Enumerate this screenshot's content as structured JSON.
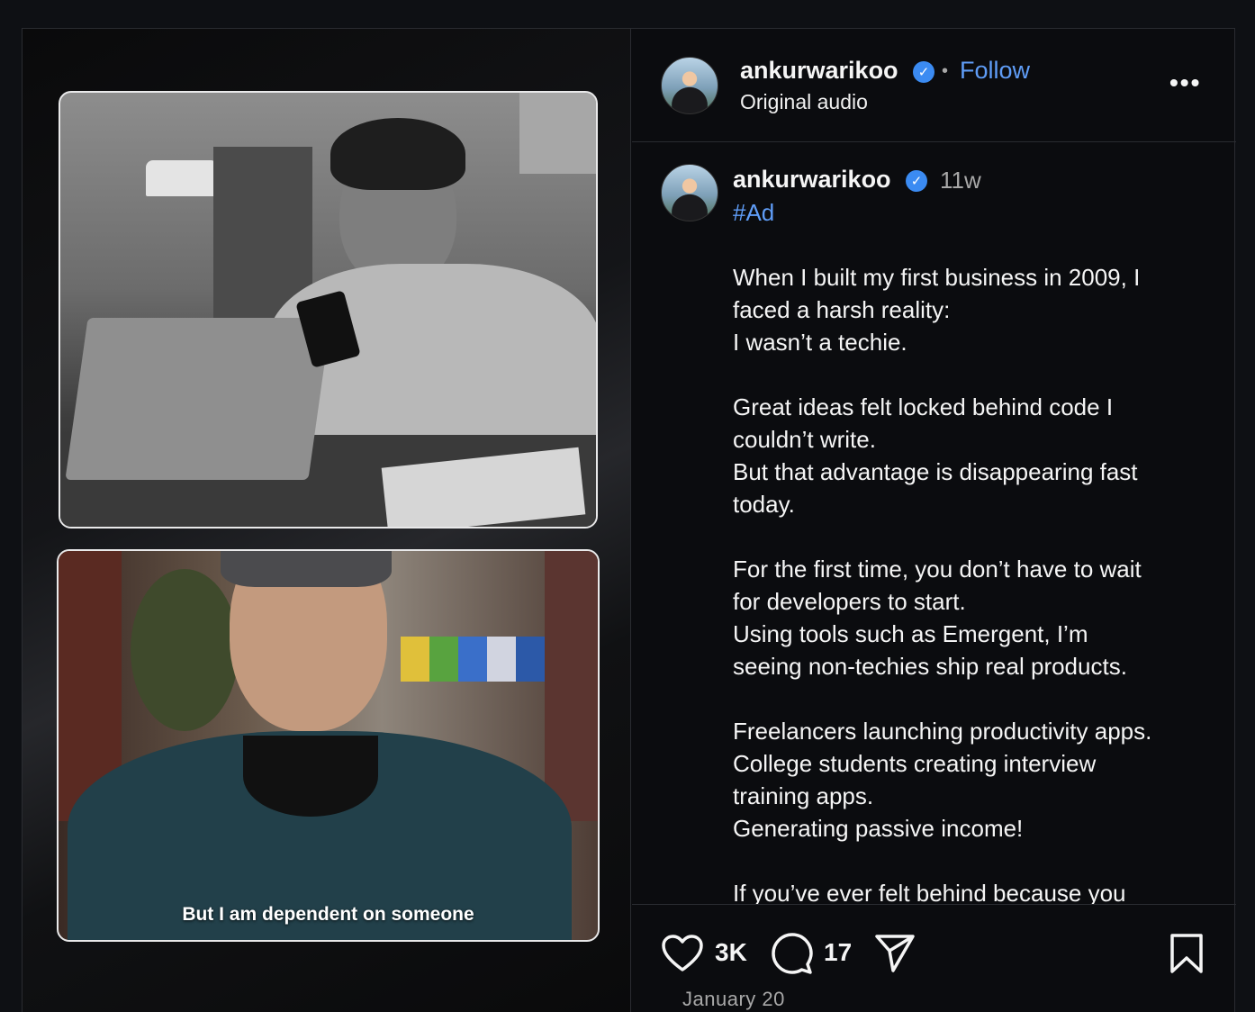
{
  "header": {
    "username": "ankurwarikoo",
    "separator": "•",
    "follow_label": "Follow",
    "subtitle": "Original audio",
    "more_label": "•••"
  },
  "post": {
    "username": "ankurwarikoo",
    "time_ago": "11w",
    "hashtag": "#Ad",
    "paragraphs": [
      [
        "When I built my first business in 2009, I",
        "faced a harsh reality:",
        "I wasn’t a techie."
      ],
      [
        "Great ideas felt locked behind code I",
        "couldn’t write.",
        "But that advantage is disappearing fast",
        "today."
      ],
      [
        "For the first time, you don’t have to wait",
        "for developers to start.",
        "Using tools such as Emergent, I’m",
        "seeing non-techies ship real products."
      ],
      [
        "Freelancers launching productivity apps.",
        "College students creating interview",
        "training apps.",
        "Generating passive income!"
      ],
      [
        "If you’ve ever felt behind because you"
      ]
    ]
  },
  "media": {
    "caption": "But I am dependent on someone"
  },
  "actions": {
    "likes": "3K",
    "comments": "17",
    "date": "January 20"
  },
  "colors": {
    "accent": "#5f9df7",
    "verified": "#3b8bf2",
    "background": "#0e1014"
  },
  "icons": [
    "verified-badge-icon",
    "heart-icon",
    "comment-icon",
    "share-icon",
    "bookmark-icon",
    "more-icon"
  ]
}
